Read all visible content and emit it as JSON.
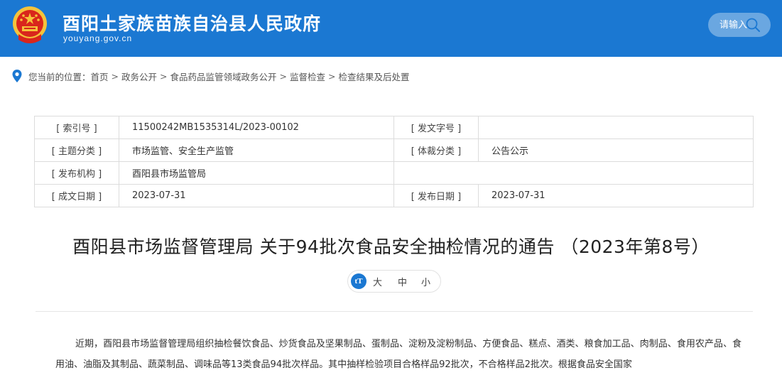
{
  "header": {
    "site_title": "酉阳土家族苗族自治县人民政府",
    "site_domain": "youyang.gov.cn",
    "search_placeholder": "请输入",
    "brand_color": "#1b78d2"
  },
  "breadcrumb": {
    "prefix": "您当前的位置：",
    "items": [
      "首页",
      "政务公开",
      "食品药品监管领域政务公开",
      "监督检查",
      "检查结果及后处置"
    ],
    "separator": ">"
  },
  "info": {
    "index_no_label": "[ 索引号 ]",
    "index_no_value": "11500242MB1535314L/2023-00102",
    "doc_no_label": "[ 发文字号 ]",
    "doc_no_value": "",
    "topic_label": "[ 主题分类 ]",
    "topic_value": "市场监管、安全生产监管",
    "genre_label": "[ 体裁分类 ]",
    "genre_value": "公告公示",
    "issuer_label": "[ 发布机构 ]",
    "issuer_value": "酉阳县市场监管局",
    "created_label": "[ 成文日期 ]",
    "created_value": "2023-07-31",
    "published_label": "[ 发布日期 ]",
    "published_value": "2023-07-31"
  },
  "article": {
    "title": "酉阳县市场监督管理局 关于94批次食品安全抽检情况的通告 （2023年第8号）",
    "font_icon": "tT",
    "font_large": "大",
    "font_medium": "中",
    "font_small": "小",
    "body": "近期，酉阳县市场监督管理局组织抽检餐饮食品、炒货食品及坚果制品、蛋制品、淀粉及淀粉制品、方便食品、糕点、酒类、粮食加工品、肉制品、食用农产品、食用油、油脂及其制品、蔬菜制品、调味品等13类食品94批次样品。其中抽样检验项目合格样品92批次，不合格样品2批次。根据食品安全国家"
  }
}
